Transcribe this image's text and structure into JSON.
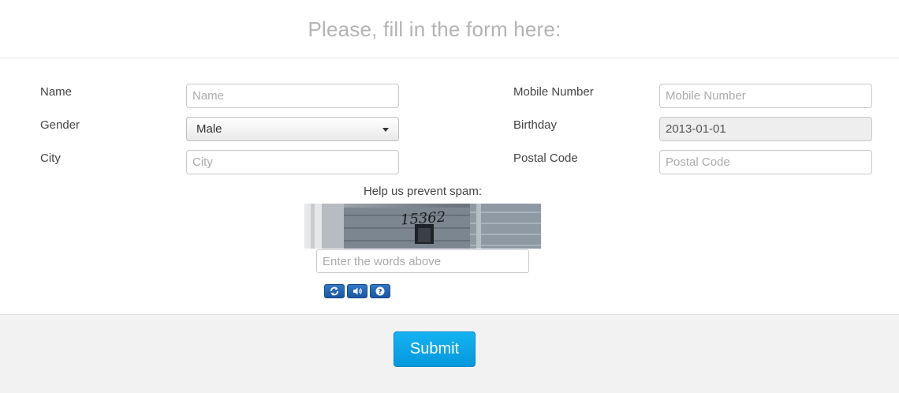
{
  "header": {
    "title": "Please, fill in the form here:"
  },
  "form": {
    "name": {
      "label": "Name",
      "placeholder": "Name",
      "value": ""
    },
    "gender": {
      "label": "Gender",
      "selected": "Male"
    },
    "city": {
      "label": "City",
      "placeholder": "City",
      "value": ""
    },
    "mobile": {
      "label": "Mobile Number",
      "placeholder": "Mobile Number",
      "value": ""
    },
    "birthday": {
      "label": "Birthday",
      "value": "2013-01-01"
    },
    "postal": {
      "label": "Postal Code",
      "placeholder": "Postal Code",
      "value": ""
    }
  },
  "captcha": {
    "label": "Help us prevent spam:",
    "image_text": "15362",
    "input_placeholder": "Enter the words above",
    "buttons": {
      "refresh_icon": "refresh-icon",
      "audio_icon": "speaker-icon",
      "help_icon": "help-icon"
    }
  },
  "footer": {
    "submit_label": "Submit"
  },
  "colors": {
    "accent": "#0a9fe4",
    "title": "#b3b3b3",
    "captcha_btn": "#1f62ad"
  }
}
